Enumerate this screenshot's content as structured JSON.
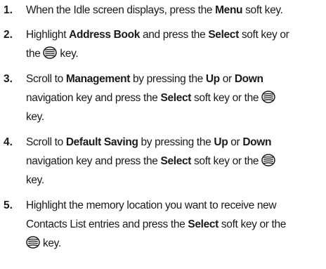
{
  "steps": [
    {
      "number": "1.",
      "lines": [
        [
          {
            "t": "When the Idle screen displays, press the "
          },
          {
            "t": "Menu",
            "b": true
          },
          {
            "t": " soft key."
          }
        ]
      ]
    },
    {
      "number": "2.",
      "lines": [
        [
          {
            "t": "Highlight "
          },
          {
            "t": "Address Book",
            "b": true
          },
          {
            "t": " and press the "
          },
          {
            "t": "Select",
            "b": true
          },
          {
            "t": " soft key or"
          }
        ],
        [
          {
            "t": "the "
          },
          {
            "icon": "ok-key-icon"
          },
          {
            "t": " key."
          }
        ]
      ]
    },
    {
      "number": "3.",
      "lines": [
        [
          {
            "t": "Scroll to "
          },
          {
            "t": "Management",
            "b": true
          },
          {
            "t": " by pressing the "
          },
          {
            "t": "Up",
            "b": true
          },
          {
            "t": " or "
          },
          {
            "t": "Down",
            "b": true
          }
        ],
        [
          {
            "t": "navigation key and press the "
          },
          {
            "t": "Select",
            "b": true
          },
          {
            "t": " soft key or the "
          },
          {
            "icon": "ok-key-icon"
          }
        ],
        [
          {
            "t": "key."
          }
        ]
      ]
    },
    {
      "number": "4.",
      "lines": [
        [
          {
            "t": "Scroll to "
          },
          {
            "t": "Default Saving",
            "b": true
          },
          {
            "t": " by pressing the "
          },
          {
            "t": "Up",
            "b": true
          },
          {
            "t": " or "
          },
          {
            "t": "Down",
            "b": true
          }
        ],
        [
          {
            "t": "navigation key and press the "
          },
          {
            "t": "Select",
            "b": true
          },
          {
            "t": " soft key or the "
          },
          {
            "icon": "ok-key-icon"
          }
        ],
        [
          {
            "t": "key."
          }
        ]
      ]
    },
    {
      "number": "5.",
      "lines": [
        [
          {
            "t": "Highlight the memory location you want to receive new"
          }
        ],
        [
          {
            "t": "Contacts List entries and press the "
          },
          {
            "t": "Select",
            "b": true
          },
          {
            "t": " soft key or the"
          }
        ],
        [
          {
            "icon": "ok-key-icon"
          },
          {
            "t": " key."
          }
        ]
      ]
    }
  ]
}
